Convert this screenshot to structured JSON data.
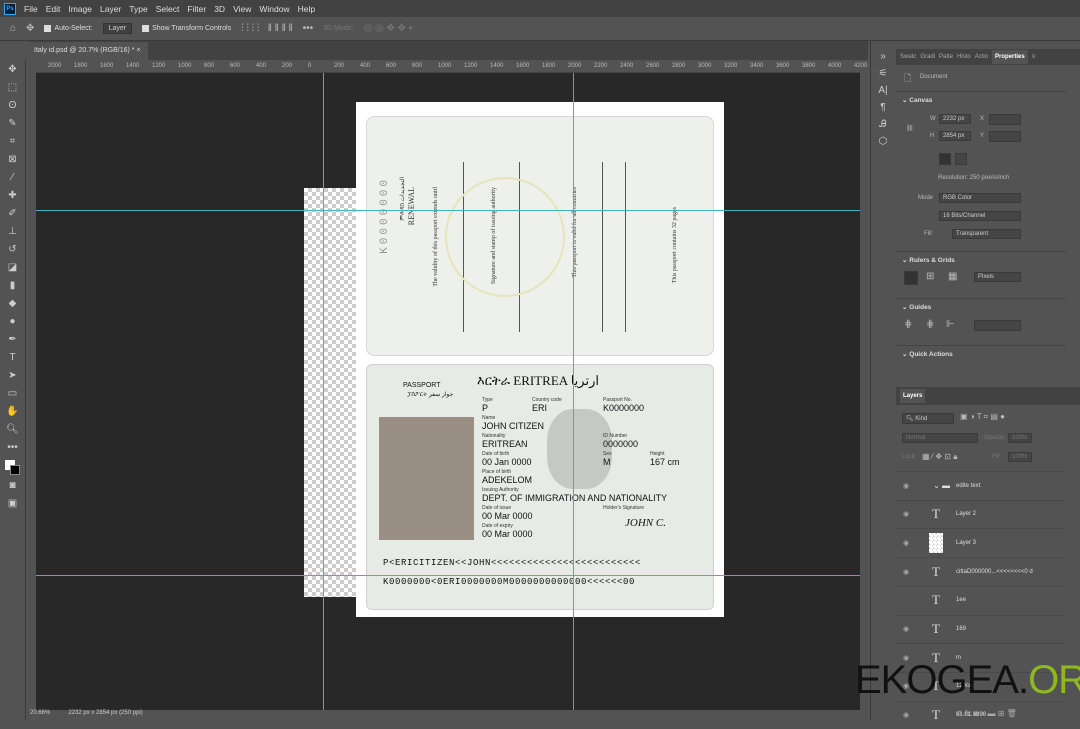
{
  "menu": [
    "File",
    "Edit",
    "Image",
    "Layer",
    "Type",
    "Select",
    "Filter",
    "3D",
    "View",
    "Window",
    "Help"
  ],
  "options": {
    "auto_select": "Auto-Select:",
    "layer_select": "Layer",
    "show_transform": "Show Transform Controls",
    "mode_3d": "3D Mode:"
  },
  "doc_tab": "Italy id.psd @ 20.7% (RGB/16) *",
  "status": {
    "zoom": "20.66%",
    "size": "2232 px x 2854 px (250 ppi)"
  },
  "properties": {
    "tabs": [
      "Swatc",
      "Gradi",
      "Patte",
      "Histo",
      "Actio",
      "Properties"
    ],
    "document": "Document",
    "canvas": "Canvas",
    "w": "2232 px",
    "h": "2854 px",
    "x_label": "X",
    "y_label": "Y",
    "w_label": "W",
    "h_label": "H",
    "resolution": "Resolution: 250 pixels/inch",
    "mode_label": "Mode",
    "mode": "RGB Color",
    "bits": "16 Bits/Channel",
    "fill_label": "Fill",
    "fill": "Transparent",
    "rulers": "Rulers & Grids",
    "units": "Pixels",
    "guides": "Guides",
    "quick": "Quick Actions"
  },
  "layers": {
    "title": "Layers",
    "kind": "Kind",
    "blend": "Normal",
    "opacity": "Opacity:",
    "opacity_val": "100%",
    "lock": "Lock:",
    "fill": "Fill:",
    "fill_val": "100%",
    "items": [
      {
        "name": "edite text",
        "type": "group"
      },
      {
        "name": "Layer 2",
        "type": "text"
      },
      {
        "name": "Layer 3",
        "type": "pixel"
      },
      {
        "name": "cittaD000000...<<<<<<<<0 d",
        "type": "text"
      },
      {
        "name": "1ee",
        "type": "text"
      },
      {
        "name": "169",
        "type": "text"
      },
      {
        "name": "m",
        "type": "text"
      },
      {
        "name": "120cm",
        "type": "text"
      },
      {
        "name": "01.01.1990",
        "type": "text"
      }
    ]
  },
  "passport": {
    "upper": {
      "renewal": "RENEWAL",
      "renewal_local": "ምሕዳስ  التجديدات",
      "validity": "The validity of this passport extends until",
      "signature": "Signature and stamp of issuing authority",
      "valid_for": "This passport is valid for all countries",
      "pages": "This passport contains 32 pages"
    },
    "header": "እርትራ ERITREA ارتريا",
    "passport_label": "PASSPORT",
    "passport_local": "ፓስፖርት جواز سفر",
    "fields": [
      {
        "label": "Type",
        "value": "P"
      },
      {
        "label": "Country code",
        "value": "ERI"
      },
      {
        "label": "Passport No.",
        "value": "K0000000"
      },
      {
        "label": "Name",
        "value": "JOHN CITIZEN"
      },
      {
        "label": "Nationality",
        "value": "ERITREAN"
      },
      {
        "label": "ID Number",
        "value": "0000000"
      },
      {
        "label": "Date of birth",
        "value": "00 Jan 0000"
      },
      {
        "label": "Sex",
        "value": "M"
      },
      {
        "label": "Height",
        "value": "167 cm"
      },
      {
        "label": "Place of birth",
        "value": "ADEKELOM"
      },
      {
        "label": "Issuing Authority",
        "value": "DEPT. OF IMMIGRATION AND NATIONALITY"
      },
      {
        "label": "Date of issue",
        "value": "00 Mar 0000"
      },
      {
        "label": "Holder's Signature",
        "value": "JOHN C."
      },
      {
        "label": "Date of expiry",
        "value": "00 Mar 0000"
      }
    ],
    "mrz1": "P<ERICITIZEN<<JOHN<<<<<<<<<<<<<<<<<<<<<<<<<",
    "mrz2": "K0000000<0ERI0000000M0000000000000<<<<<<00"
  },
  "watermark": {
    "a": "EKOGEA.",
    "b": "ORG"
  }
}
